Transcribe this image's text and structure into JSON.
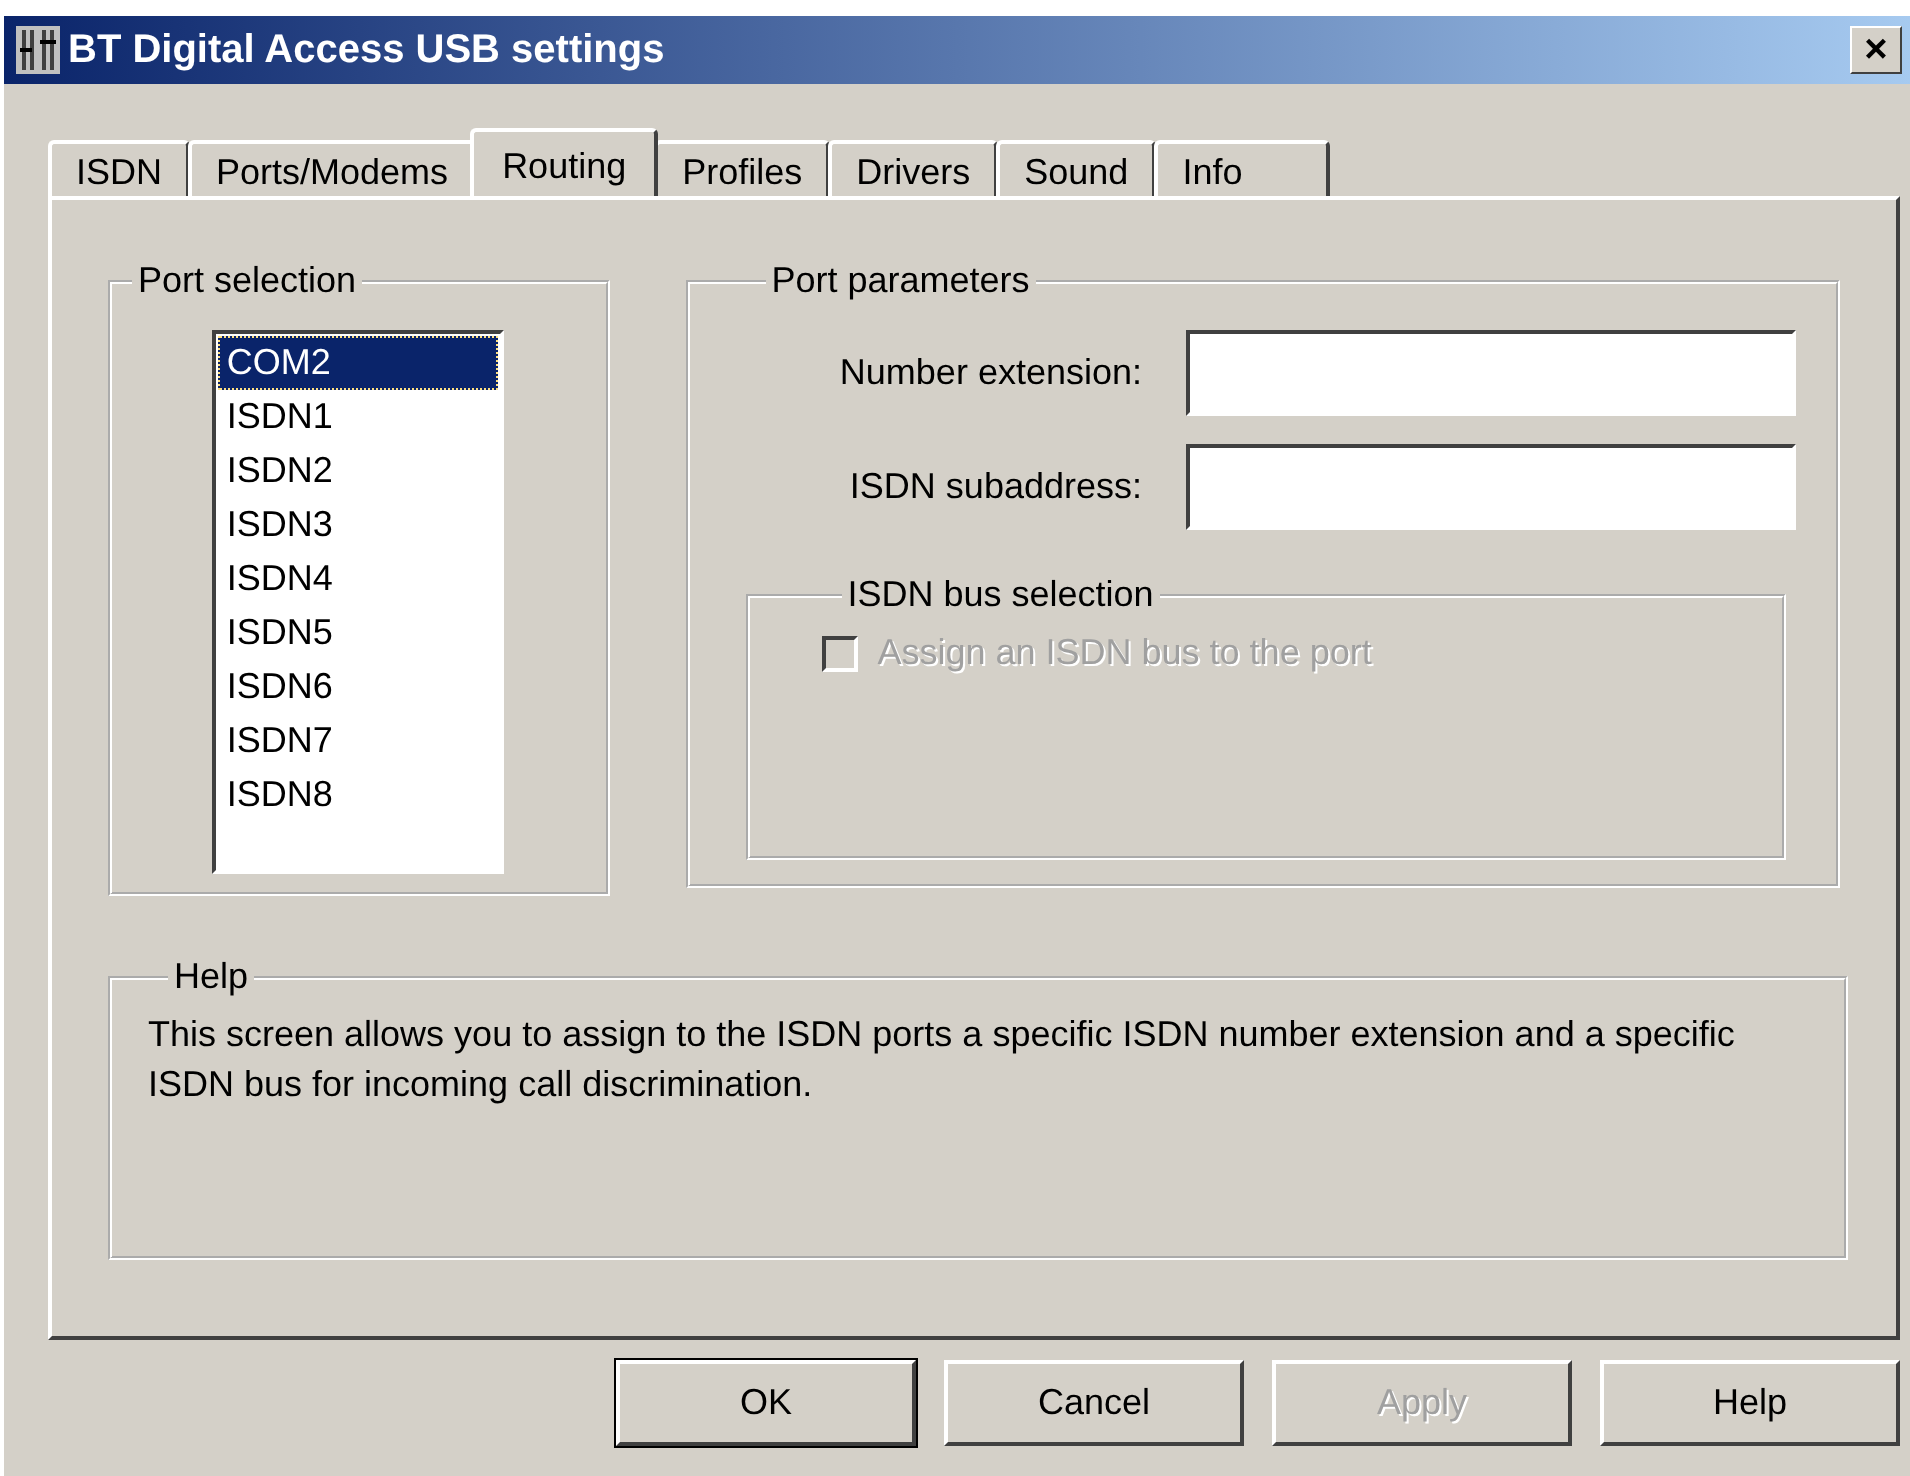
{
  "window": {
    "title": "BT Digital Access USB settings",
    "close": "×"
  },
  "tabs": [
    {
      "label": "ISDN",
      "selected": false
    },
    {
      "label": "Ports/Modems",
      "selected": false
    },
    {
      "label": "Routing",
      "selected": true
    },
    {
      "label": "Profiles",
      "selected": false
    },
    {
      "label": "Drivers",
      "selected": false
    },
    {
      "label": "Sound",
      "selected": false
    },
    {
      "label": "Info",
      "selected": false
    }
  ],
  "port_selection": {
    "title": "Port selection",
    "items": [
      {
        "label": "COM2",
        "selected": true
      },
      {
        "label": "ISDN1",
        "selected": false
      },
      {
        "label": "ISDN2",
        "selected": false
      },
      {
        "label": "ISDN3",
        "selected": false
      },
      {
        "label": "ISDN4",
        "selected": false
      },
      {
        "label": "ISDN5",
        "selected": false
      },
      {
        "label": "ISDN6",
        "selected": false
      },
      {
        "label": "ISDN7",
        "selected": false
      },
      {
        "label": "ISDN8",
        "selected": false
      }
    ]
  },
  "port_parameters": {
    "title": "Port parameters",
    "fields": [
      {
        "label": "Number extension:"
      },
      {
        "label": "ISDN subaddress:"
      }
    ],
    "bus_selection": {
      "title": "ISDN bus selection",
      "checkbox": {
        "label": "Assign an ISDN bus to the port",
        "checked": false,
        "disabled": true
      }
    }
  },
  "help": {
    "title": "Help",
    "text": "This screen allows you to assign to the ISDN ports a specific ISDN number extension and a specific ISDN bus for incoming call discrimination."
  },
  "buttons": [
    {
      "label": "OK",
      "default": true,
      "disabled": false
    },
    {
      "label": "Cancel",
      "default": false,
      "disabled": false
    },
    {
      "label": "Apply",
      "default": false,
      "disabled": true
    },
    {
      "label": "Help",
      "default": false,
      "disabled": false
    }
  ]
}
